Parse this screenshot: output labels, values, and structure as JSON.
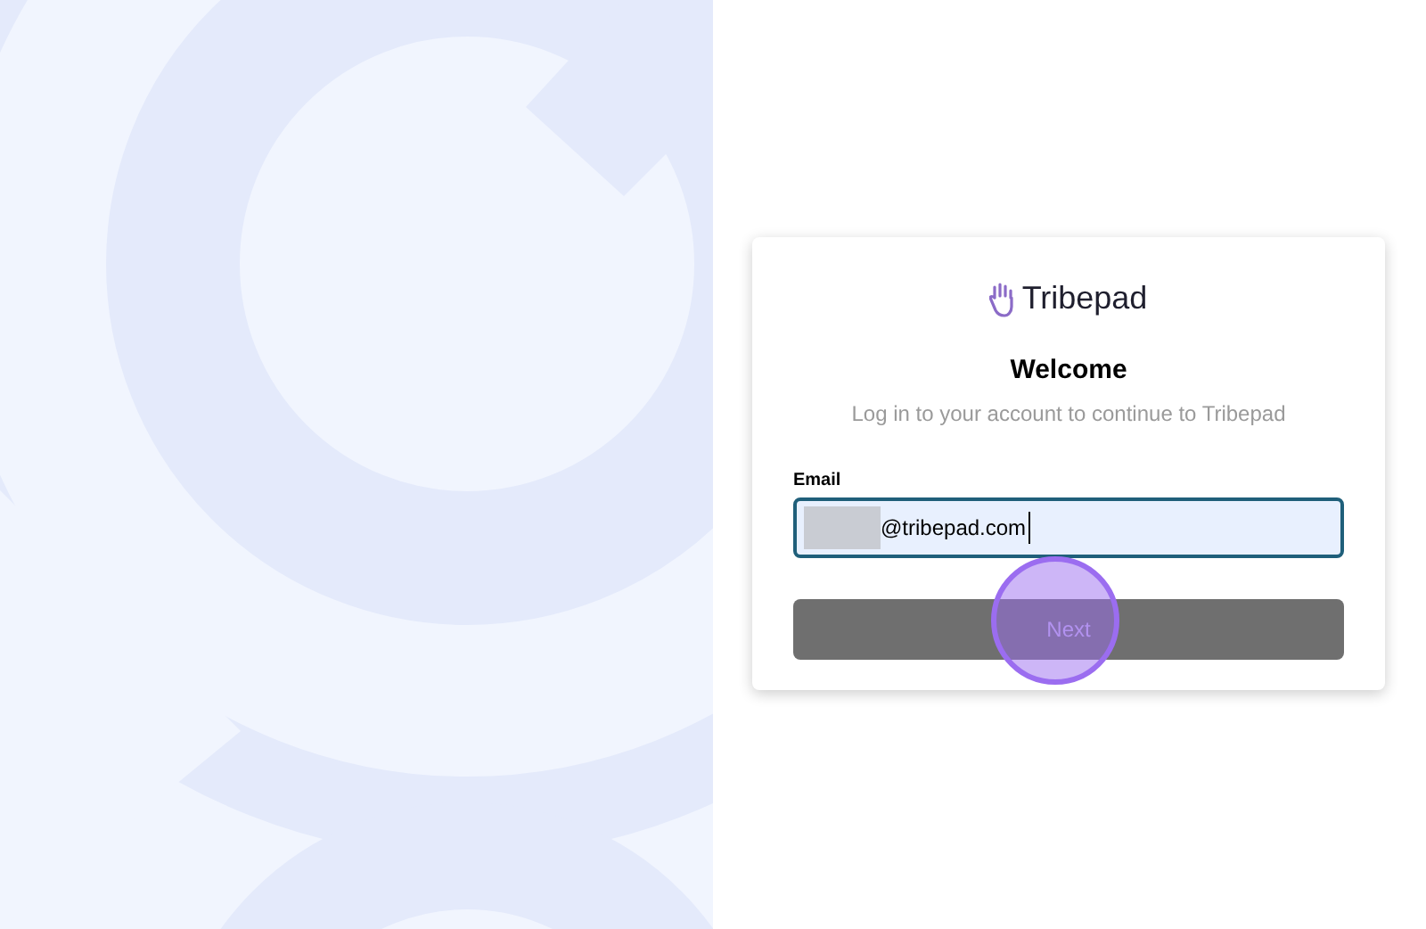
{
  "brand": {
    "name": "Tribepad"
  },
  "heading": "Welcome",
  "subtitle": "Log in to your account to continue to Tribepad",
  "email": {
    "label": "Email",
    "value": "@tribepad.com",
    "redacted_prefix": true
  },
  "next_button": {
    "label": "Next",
    "disabled": true
  },
  "click_highlight": true
}
